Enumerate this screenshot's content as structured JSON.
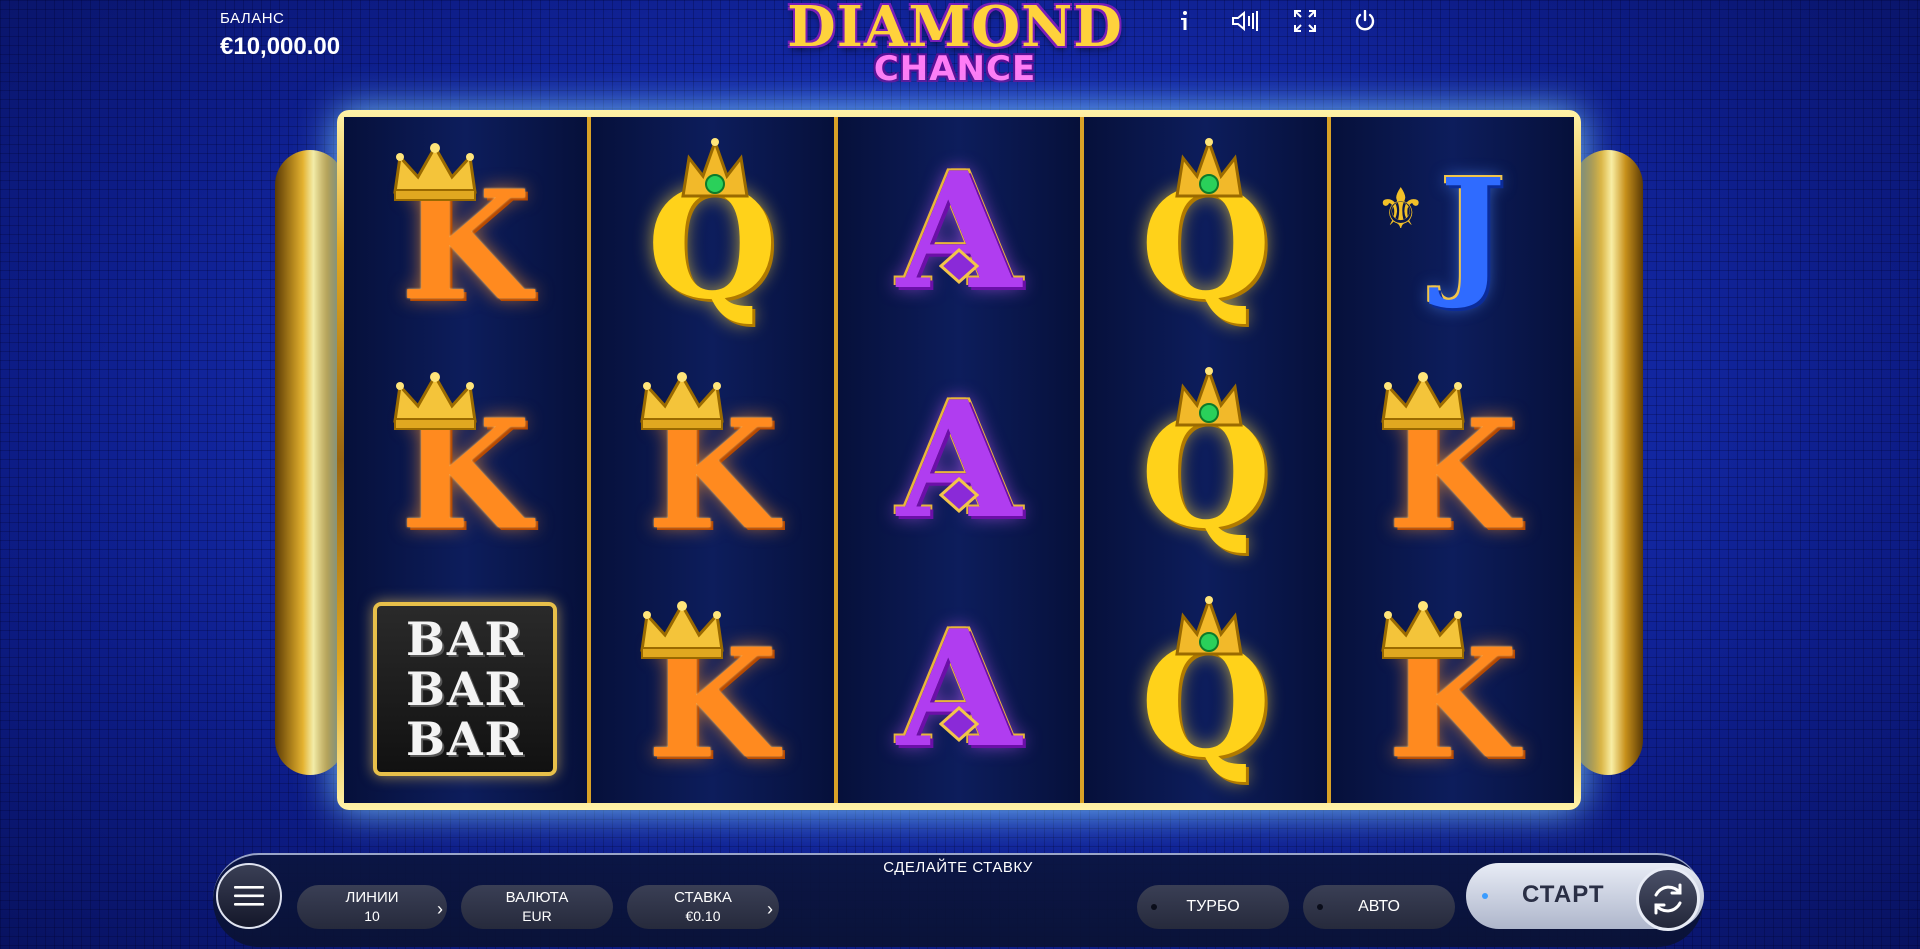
{
  "balance": {
    "label": "БАЛАНС",
    "value": "€10,000.00"
  },
  "logo": {
    "line1": "DIAMOND",
    "line2": "CHANCE"
  },
  "top_icons": [
    "info-icon",
    "sound-icon",
    "fullscreen-icon",
    "power-icon"
  ],
  "reels": [
    [
      {
        "type": "K",
        "label": "K"
      },
      {
        "type": "K",
        "label": "K"
      },
      {
        "type": "BAR",
        "label": "BAR"
      }
    ],
    [
      {
        "type": "Q",
        "label": "Q"
      },
      {
        "type": "K",
        "label": "K"
      },
      {
        "type": "K",
        "label": "K"
      }
    ],
    [
      {
        "type": "A",
        "label": "A"
      },
      {
        "type": "A",
        "label": "A"
      },
      {
        "type": "A",
        "label": "A"
      }
    ],
    [
      {
        "type": "Q",
        "label": "Q"
      },
      {
        "type": "Q",
        "label": "Q"
      },
      {
        "type": "Q",
        "label": "Q"
      }
    ],
    [
      {
        "type": "J",
        "label": "J"
      },
      {
        "type": "K",
        "label": "K"
      },
      {
        "type": "K",
        "label": "K"
      }
    ]
  ],
  "controls": {
    "message": "СДЕЛАЙТЕ СТАВКУ",
    "lines": {
      "label": "ЛИНИИ",
      "value": "10"
    },
    "currency": {
      "label": "ВАЛЮТА",
      "value": "EUR"
    },
    "bet": {
      "label": "СТАВКА",
      "value": "€0.10"
    },
    "turbo": "ТУРБО",
    "auto": "АВТО",
    "start": "СТАРТ"
  },
  "colors": {
    "k": "#ff8a1f",
    "q": "#ffd21a",
    "a": "#b03df0",
    "j": "#2f6bff",
    "frame": "#e2a820"
  }
}
